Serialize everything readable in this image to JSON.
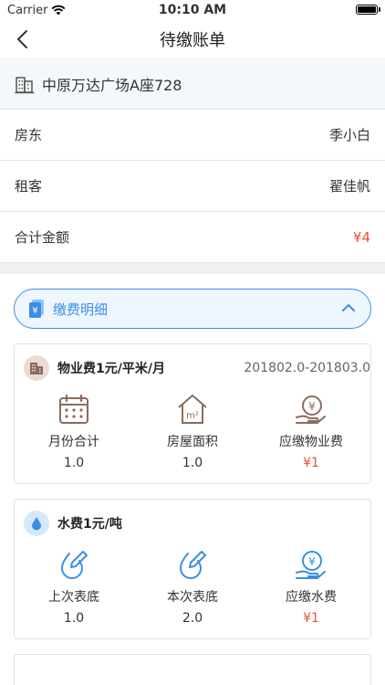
{
  "status": {
    "carrier": "Carrier",
    "time": "10:10 AM"
  },
  "nav": {
    "title": "待缴账单"
  },
  "address": "中原万达广场A座728",
  "info": [
    {
      "label": "房东",
      "value": "季小白"
    },
    {
      "label": "租客",
      "value": "翟佳帆"
    },
    {
      "label": "合计金额",
      "value": "¥4"
    }
  ],
  "detail": {
    "label": "缴费明细"
  },
  "property_fee": {
    "title": "物业费1元/平米/月",
    "period": "201802.0-201803.0",
    "items": [
      {
        "label": "月份合计",
        "value": "1.0"
      },
      {
        "label": "房屋面积",
        "value": "1.0"
      },
      {
        "label": "应缴物业费",
        "value": "¥1"
      }
    ]
  },
  "water_fee": {
    "title": "水费1元/吨",
    "items": [
      {
        "label": "上次表底",
        "value": "1.0"
      },
      {
        "label": "本次表底",
        "value": "2.0"
      },
      {
        "label": "应缴水费",
        "value": "¥1"
      }
    ]
  },
  "colors": {
    "accent": "#3a8ee6",
    "amount": "#e8542a",
    "icon_brown": "#8b6c5c"
  }
}
